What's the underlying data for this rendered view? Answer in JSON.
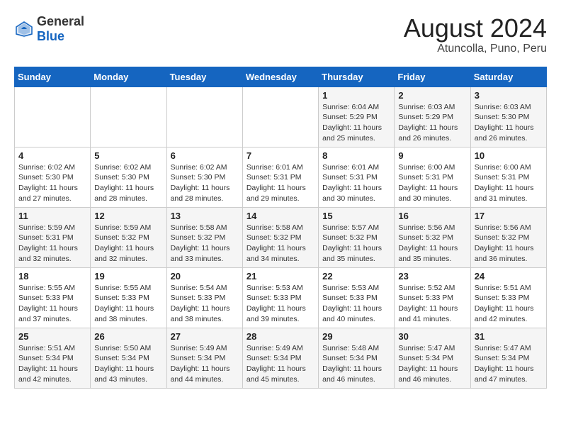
{
  "logo": {
    "general": "General",
    "blue": "Blue"
  },
  "title": "August 2024",
  "subtitle": "Atuncolla, Puno, Peru",
  "days_of_week": [
    "Sunday",
    "Monday",
    "Tuesday",
    "Wednesday",
    "Thursday",
    "Friday",
    "Saturday"
  ],
  "weeks": [
    [
      {
        "day": "",
        "info": ""
      },
      {
        "day": "",
        "info": ""
      },
      {
        "day": "",
        "info": ""
      },
      {
        "day": "",
        "info": ""
      },
      {
        "day": "1",
        "info": "Sunrise: 6:04 AM\nSunset: 5:29 PM\nDaylight: 11 hours and 25 minutes."
      },
      {
        "day": "2",
        "info": "Sunrise: 6:03 AM\nSunset: 5:29 PM\nDaylight: 11 hours and 26 minutes."
      },
      {
        "day": "3",
        "info": "Sunrise: 6:03 AM\nSunset: 5:30 PM\nDaylight: 11 hours and 26 minutes."
      }
    ],
    [
      {
        "day": "4",
        "info": "Sunrise: 6:02 AM\nSunset: 5:30 PM\nDaylight: 11 hours and 27 minutes."
      },
      {
        "day": "5",
        "info": "Sunrise: 6:02 AM\nSunset: 5:30 PM\nDaylight: 11 hours and 28 minutes."
      },
      {
        "day": "6",
        "info": "Sunrise: 6:02 AM\nSunset: 5:30 PM\nDaylight: 11 hours and 28 minutes."
      },
      {
        "day": "7",
        "info": "Sunrise: 6:01 AM\nSunset: 5:31 PM\nDaylight: 11 hours and 29 minutes."
      },
      {
        "day": "8",
        "info": "Sunrise: 6:01 AM\nSunset: 5:31 PM\nDaylight: 11 hours and 30 minutes."
      },
      {
        "day": "9",
        "info": "Sunrise: 6:00 AM\nSunset: 5:31 PM\nDaylight: 11 hours and 30 minutes."
      },
      {
        "day": "10",
        "info": "Sunrise: 6:00 AM\nSunset: 5:31 PM\nDaylight: 11 hours and 31 minutes."
      }
    ],
    [
      {
        "day": "11",
        "info": "Sunrise: 5:59 AM\nSunset: 5:31 PM\nDaylight: 11 hours and 32 minutes."
      },
      {
        "day": "12",
        "info": "Sunrise: 5:59 AM\nSunset: 5:32 PM\nDaylight: 11 hours and 32 minutes."
      },
      {
        "day": "13",
        "info": "Sunrise: 5:58 AM\nSunset: 5:32 PM\nDaylight: 11 hours and 33 minutes."
      },
      {
        "day": "14",
        "info": "Sunrise: 5:58 AM\nSunset: 5:32 PM\nDaylight: 11 hours and 34 minutes."
      },
      {
        "day": "15",
        "info": "Sunrise: 5:57 AM\nSunset: 5:32 PM\nDaylight: 11 hours and 35 minutes."
      },
      {
        "day": "16",
        "info": "Sunrise: 5:56 AM\nSunset: 5:32 PM\nDaylight: 11 hours and 35 minutes."
      },
      {
        "day": "17",
        "info": "Sunrise: 5:56 AM\nSunset: 5:32 PM\nDaylight: 11 hours and 36 minutes."
      }
    ],
    [
      {
        "day": "18",
        "info": "Sunrise: 5:55 AM\nSunset: 5:33 PM\nDaylight: 11 hours and 37 minutes."
      },
      {
        "day": "19",
        "info": "Sunrise: 5:55 AM\nSunset: 5:33 PM\nDaylight: 11 hours and 38 minutes."
      },
      {
        "day": "20",
        "info": "Sunrise: 5:54 AM\nSunset: 5:33 PM\nDaylight: 11 hours and 38 minutes."
      },
      {
        "day": "21",
        "info": "Sunrise: 5:53 AM\nSunset: 5:33 PM\nDaylight: 11 hours and 39 minutes."
      },
      {
        "day": "22",
        "info": "Sunrise: 5:53 AM\nSunset: 5:33 PM\nDaylight: 11 hours and 40 minutes."
      },
      {
        "day": "23",
        "info": "Sunrise: 5:52 AM\nSunset: 5:33 PM\nDaylight: 11 hours and 41 minutes."
      },
      {
        "day": "24",
        "info": "Sunrise: 5:51 AM\nSunset: 5:33 PM\nDaylight: 11 hours and 42 minutes."
      }
    ],
    [
      {
        "day": "25",
        "info": "Sunrise: 5:51 AM\nSunset: 5:34 PM\nDaylight: 11 hours and 42 minutes."
      },
      {
        "day": "26",
        "info": "Sunrise: 5:50 AM\nSunset: 5:34 PM\nDaylight: 11 hours and 43 minutes."
      },
      {
        "day": "27",
        "info": "Sunrise: 5:49 AM\nSunset: 5:34 PM\nDaylight: 11 hours and 44 minutes."
      },
      {
        "day": "28",
        "info": "Sunrise: 5:49 AM\nSunset: 5:34 PM\nDaylight: 11 hours and 45 minutes."
      },
      {
        "day": "29",
        "info": "Sunrise: 5:48 AM\nSunset: 5:34 PM\nDaylight: 11 hours and 46 minutes."
      },
      {
        "day": "30",
        "info": "Sunrise: 5:47 AM\nSunset: 5:34 PM\nDaylight: 11 hours and 46 minutes."
      },
      {
        "day": "31",
        "info": "Sunrise: 5:47 AM\nSunset: 5:34 PM\nDaylight: 11 hours and 47 minutes."
      }
    ]
  ]
}
